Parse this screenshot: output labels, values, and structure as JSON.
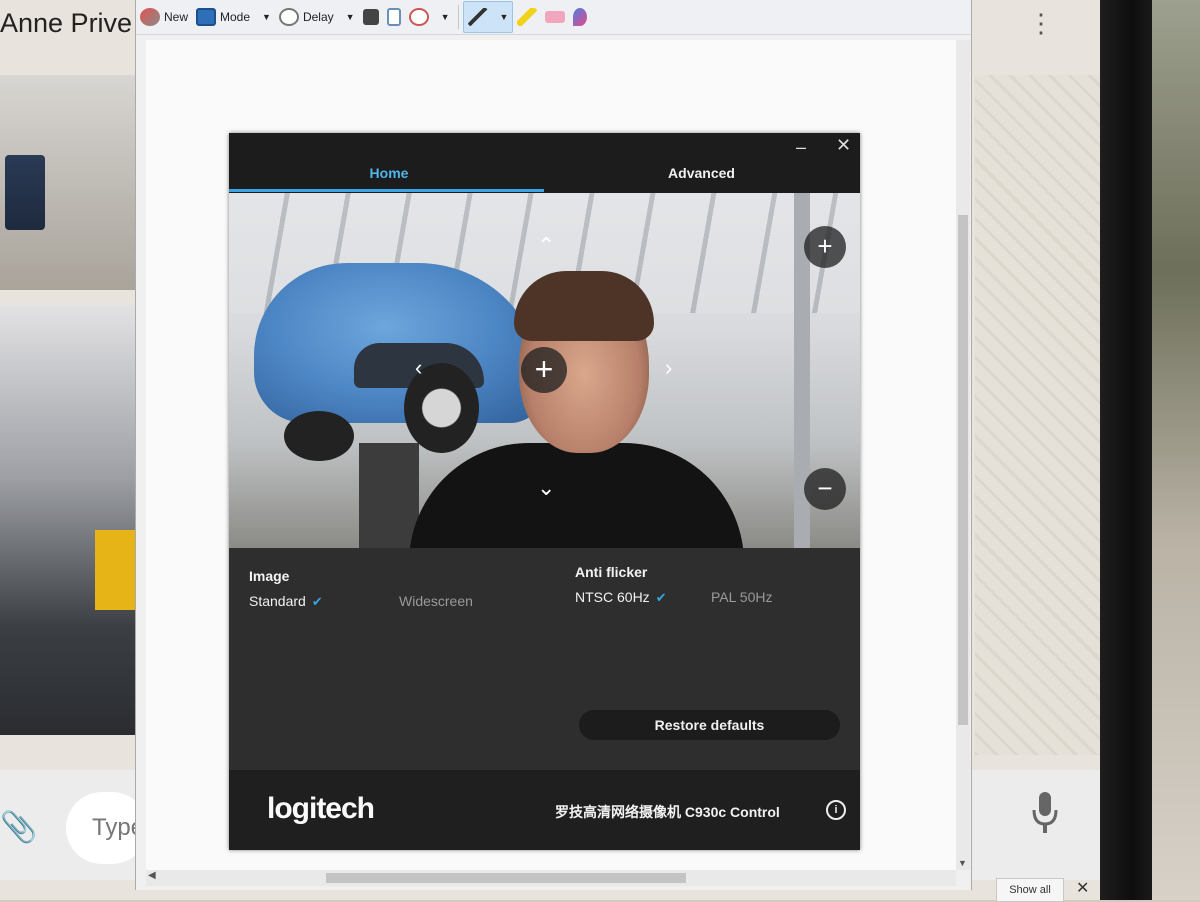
{
  "background": {
    "contact_name": "Anne Prive",
    "message_placeholder": "Type",
    "show_all": "Show all",
    "close": "✕"
  },
  "snipping_toolbar": {
    "new": "New",
    "mode": "Mode",
    "delay": "Delay"
  },
  "logitech": {
    "tabs": {
      "home": "Home",
      "advanced": "Advanced"
    },
    "window_controls": {
      "minimize": "–",
      "close": "✕"
    },
    "image": {
      "label": "Image",
      "options": [
        "Standard",
        "Widescreen"
      ],
      "selected": "Standard"
    },
    "anti_flicker": {
      "label": "Anti flicker",
      "options": [
        "NTSC 60Hz",
        "PAL 50Hz"
      ],
      "selected": "NTSC 60Hz"
    },
    "restore_defaults": "Restore defaults",
    "brand": "logitech",
    "product": "罗技高清网络摄像机 C930c Control",
    "preview_controls": {
      "pan": "+",
      "zoom_in": "+",
      "zoom_out": "−",
      "up": "⌃",
      "down": "⌄",
      "left": "‹",
      "right": "›"
    },
    "accent_color": "#3aa4e4",
    "check_mark": "✔",
    "info": "i"
  }
}
